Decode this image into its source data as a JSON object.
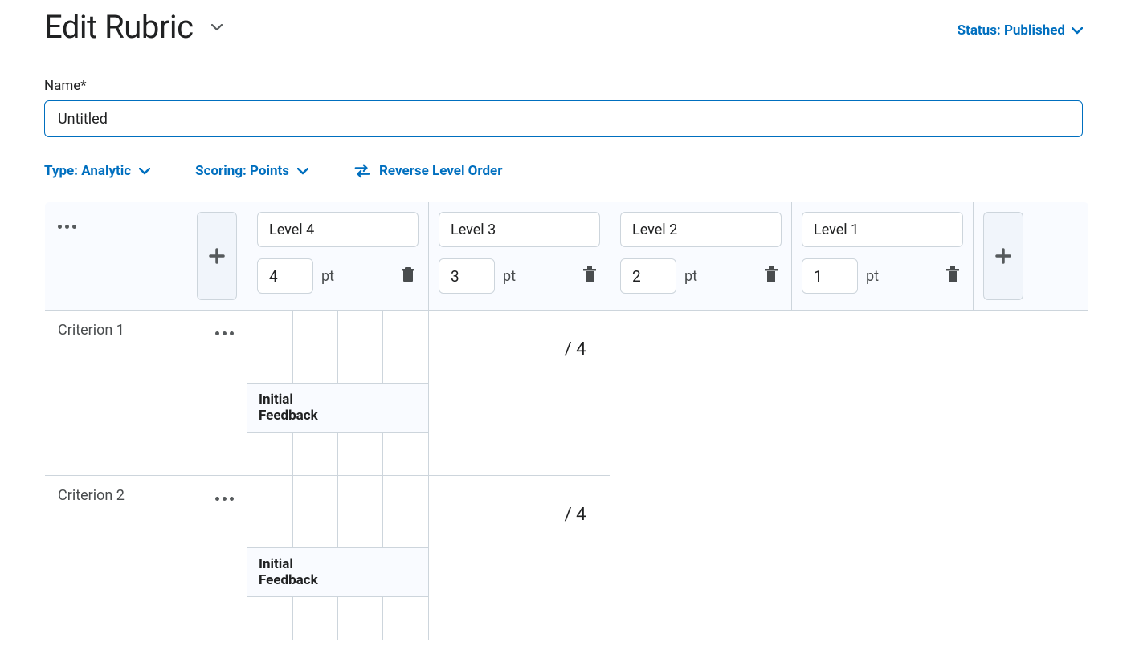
{
  "page": {
    "title": "Edit Rubric",
    "status_label": "Status: Published"
  },
  "name": {
    "label": "Name*",
    "value": "Untitled"
  },
  "toolbar": {
    "type_label": "Type: Analytic",
    "scoring_label": "Scoring: Points",
    "reverse_label": "Reverse Level Order"
  },
  "table": {
    "levels": [
      {
        "name": "Level 4",
        "points": "4",
        "unit": "pt"
      },
      {
        "name": "Level 3",
        "points": "3",
        "unit": "pt"
      },
      {
        "name": "Level 2",
        "points": "2",
        "unit": "pt"
      },
      {
        "name": "Level 1",
        "points": "1",
        "unit": "pt"
      }
    ],
    "criteria": [
      {
        "name": "Criterion 1",
        "max": "/ 4",
        "feedback_label": "Initial Feedback"
      },
      {
        "name": "Criterion 2",
        "max": "/ 4",
        "feedback_label": "Initial Feedback"
      }
    ]
  }
}
